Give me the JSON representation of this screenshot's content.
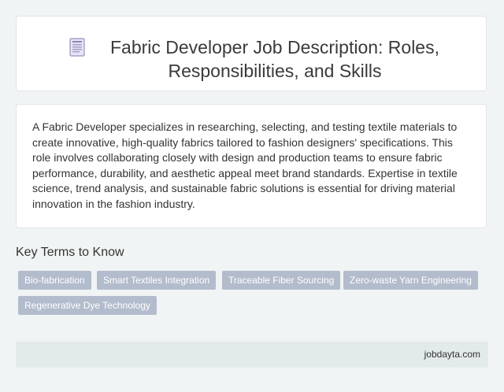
{
  "title": {
    "icon": "document-icon",
    "text": "Fabric Developer Job Description: Roles, Responsibilities, and Skills"
  },
  "description": "A Fabric Developer specializes in researching, selecting, and testing textile materials to create innovative, high-quality fabrics tailored to fashion designers' specifications. This role involves collaborating closely with design and production teams to ensure fabric performance, durability, and aesthetic appeal meet brand standards. Expertise in textile science, trend analysis, and sustainable fabric solutions is essential for driving material innovation in the fashion industry.",
  "key_terms": {
    "heading": "Key Terms to Know",
    "tags": [
      "Bio-fabrication",
      "Smart Textiles Integration",
      "Traceable Fiber Sourcing",
      "Zero-waste Yarn Engineering",
      "Regenerative Dye Technology"
    ]
  },
  "footer": {
    "site": "jobdayta.com"
  },
  "colors": {
    "background": "#f1f4f4",
    "card": "#ffffff",
    "tag": "#b3bccc",
    "footer": "#e3eaea",
    "icon_accent": "#9b8fc4"
  }
}
